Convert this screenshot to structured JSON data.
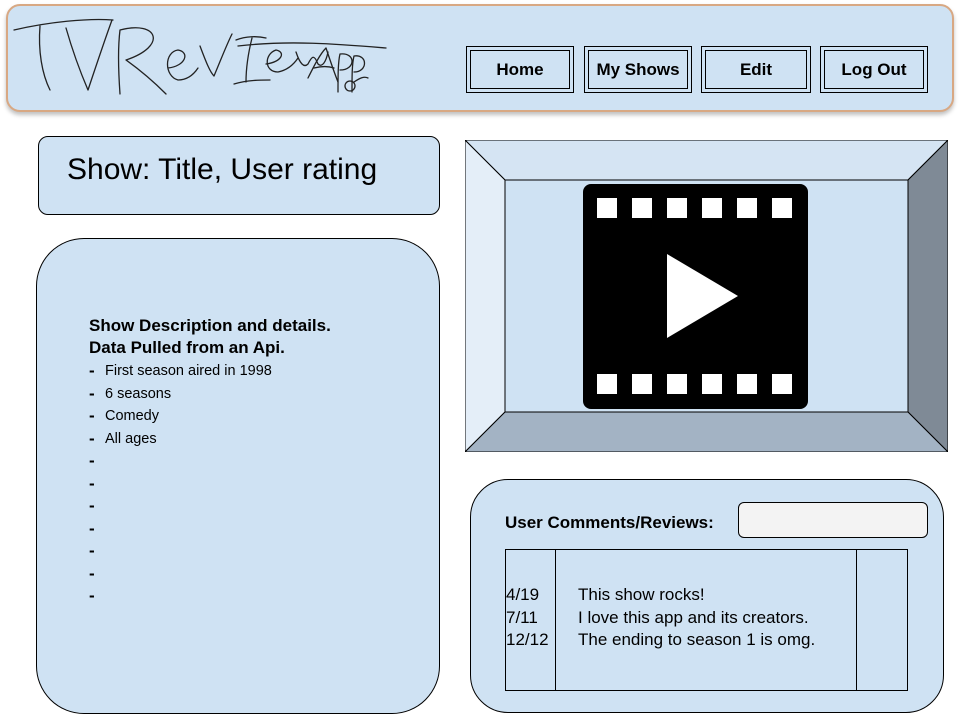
{
  "header": {
    "logo_text": "TVReviewApp",
    "nav": [
      {
        "label": "Home"
      },
      {
        "label": "My Shows"
      },
      {
        "label": "Edit"
      },
      {
        "label": "Log Out"
      }
    ]
  },
  "show": {
    "title": "Show: Title, User rating"
  },
  "description": {
    "heading_line1": "Show Description and details.",
    "heading_line2": "Data Pulled from an Api.",
    "items": [
      "First season aired in 1998",
      "6 seasons",
      "Comedy",
      "All ages",
      "",
      "",
      "",
      "",
      "",
      "",
      ""
    ]
  },
  "video": {
    "icon": "play-icon",
    "colors": {
      "frame_top": "#d5e4f3",
      "frame_right": "#7f8a96",
      "frame_bottom": "#a3b3c4",
      "screen": "#cfe2f3"
    }
  },
  "comments": {
    "label": "User Comments/Reviews:",
    "input_value": "",
    "rows": [
      {
        "date": "4/19",
        "text": "This show rocks!"
      },
      {
        "date": "7/11",
        "text": "I love this app and its creators."
      },
      {
        "date": "12/12",
        "text": "The ending to season 1 is omg."
      }
    ]
  },
  "colors": {
    "panel": "#cfe2f3",
    "header_border": "#d8a883"
  }
}
